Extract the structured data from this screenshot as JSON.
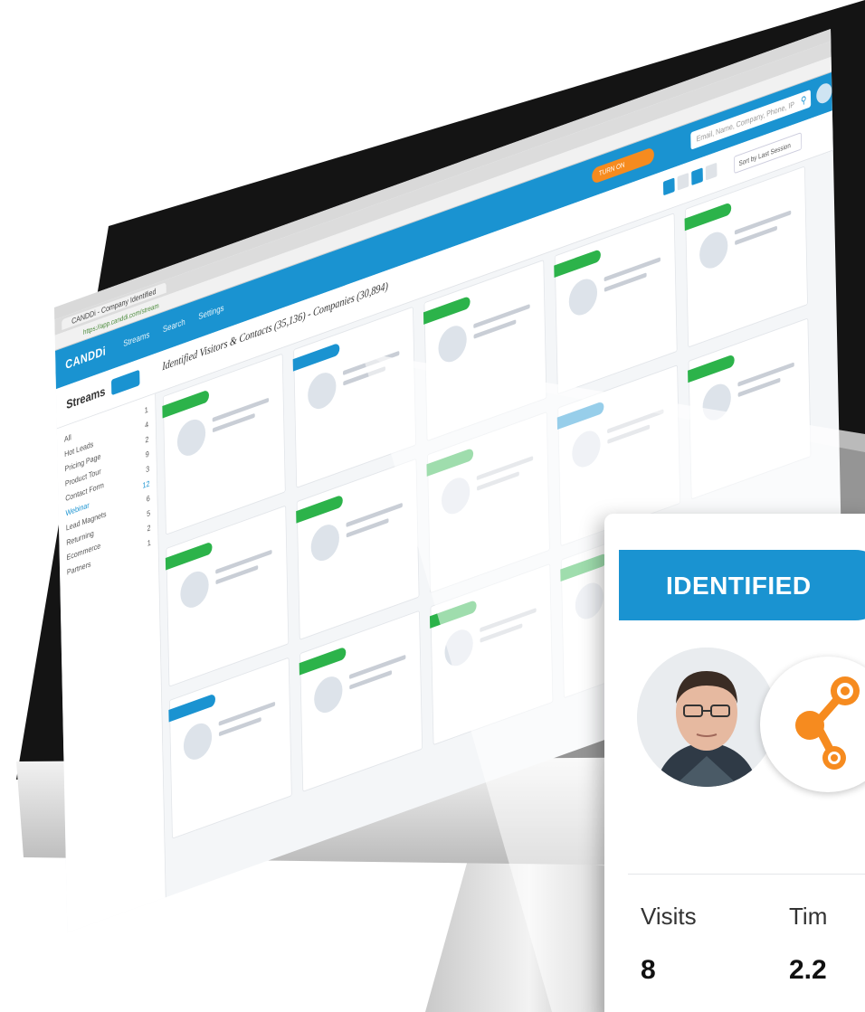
{
  "app": {
    "logo": "CANDDi",
    "nav": [
      "Streams",
      "Search",
      "Settings"
    ],
    "browser_tab": "CANDDi - Company Identified",
    "url": "https://app.canddi.com/stream"
  },
  "topbar": {
    "toggle_label": "TURN ON",
    "search_placeholder": "Email, Name, Company, Phone, IP"
  },
  "header": {
    "streams_title": "Streams",
    "headline": "Identified Visitors & Contacts (35,136) - Companies (30,894)",
    "sort_label": "Sort by Last Session"
  },
  "sidebar": {
    "items": [
      {
        "label": "All",
        "count": "1"
      },
      {
        "label": "Hot Leads",
        "count": "4"
      },
      {
        "label": "Pricing Page",
        "count": "2"
      },
      {
        "label": "Product Tour",
        "count": "9"
      },
      {
        "label": "Contact Form",
        "count": "3"
      },
      {
        "label": "Webinar",
        "count": "12"
      },
      {
        "label": "Lead Magnets",
        "count": "6"
      },
      {
        "label": "Returning",
        "count": "5"
      },
      {
        "label": "Ecommerce",
        "count": "2"
      },
      {
        "label": "Partners",
        "count": "1"
      }
    ]
  },
  "zoom_card": {
    "status": "IDENTIFIED",
    "stats": [
      {
        "label": "Visits",
        "value": "8"
      },
      {
        "label": "Tim",
        "value": "2.2"
      }
    ],
    "colors": {
      "identified": "#1a93d1",
      "brand_orange": "#f68b1f"
    }
  }
}
